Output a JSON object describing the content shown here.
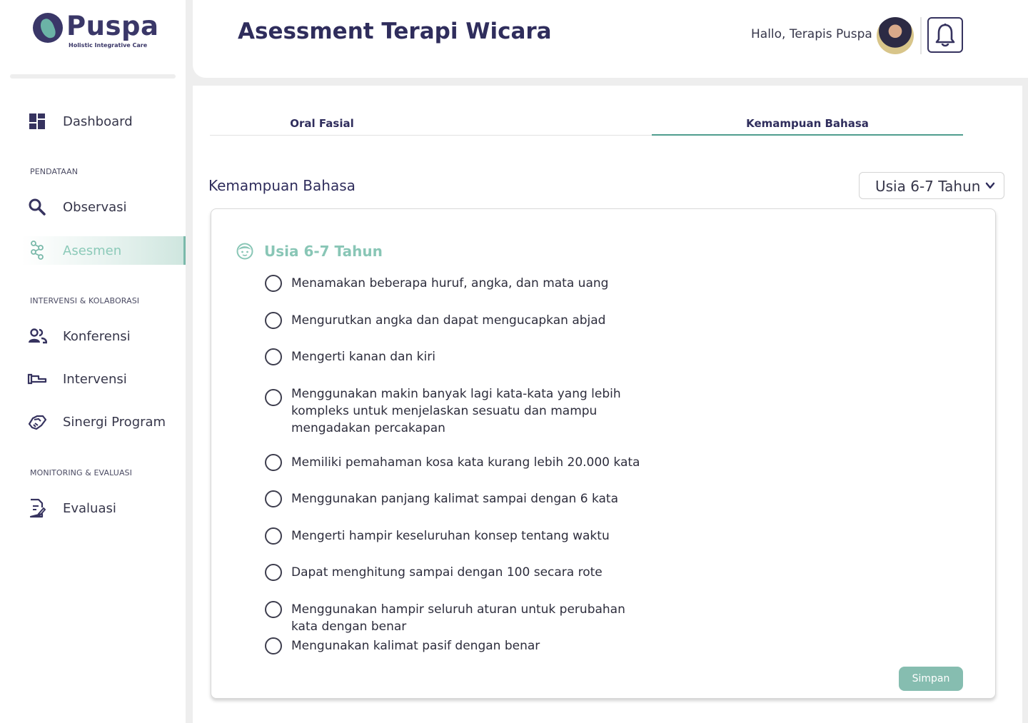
{
  "brand": {
    "name": "Puspa",
    "tagline": "Holistic Integrative Care"
  },
  "sidebar": {
    "dashboard": {
      "label": "Dashboard",
      "icon": "dashboard-icon"
    },
    "sections": [
      {
        "title": "PENDATAAN",
        "items": [
          {
            "label": "Observasi",
            "icon": "search-icon"
          },
          {
            "label": "Asesmen",
            "icon": "molecule-icon",
            "active": true
          }
        ]
      },
      {
        "title": "INTERVENSI & KOLABORASI",
        "items": [
          {
            "label": "Konferensi",
            "icon": "people-icon"
          },
          {
            "label": "Intervensi",
            "icon": "hand-icon"
          },
          {
            "label": "Sinergi Program",
            "icon": "handshake-icon"
          }
        ]
      },
      {
        "title": "MONITORING & EVALUASI",
        "items": [
          {
            "label": "Evaluasi",
            "icon": "document-edit-icon"
          }
        ]
      }
    ]
  },
  "header": {
    "title": "Asessment Terapi Wicara",
    "greeting": "Hallo, Terapis Puspa"
  },
  "tabs": [
    {
      "label": "Oral Fasial",
      "active": false
    },
    {
      "label": "Kemampuan Bahasa",
      "active": true
    }
  ],
  "main": {
    "section_title": "Kemampuan Bahasa",
    "age_select": {
      "value": "Usia 6-7 Tahun"
    },
    "card": {
      "title": "Usia 6-7 Tahun",
      "items": [
        "Menamakan beberapa huruf, angka, dan mata uang",
        "Mengurutkan angka dan dapat mengucapkan abjad",
        "Mengerti kanan dan kiri",
        "Menggunakan makin banyak lagi kata-kata yang lebih kompleks untuk menjelaskan sesuatu dan mampu mengadakan percakapan",
        "Memiliki pemahaman kosa kata kurang lebih 20.000 kata",
        "Menggunakan panjang kalimat sampai dengan 6 kata",
        "Mengerti hampir keseluruhan konsep tentang waktu",
        "Dapat menghitung sampai dengan 100 secara rote",
        "Menggunakan hampir seluruh aturan untuk perubahan kata dengan benar",
        "Mengunakan kalimat pasif dengan benar"
      ]
    },
    "save_label": "Simpan"
  },
  "colors": {
    "brand": "#3a3768",
    "accent": "#7ab9aa",
    "save": "#86bdb0"
  }
}
